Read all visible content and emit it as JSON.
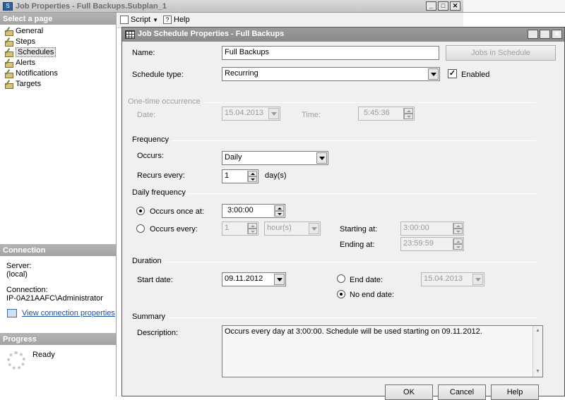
{
  "outer_window": {
    "title": "Job Properties - Full Backups.Subplan_1",
    "select_page_header": "Select a page",
    "pages": [
      {
        "label": "General"
      },
      {
        "label": "Steps"
      },
      {
        "label": "Schedules"
      },
      {
        "label": "Alerts"
      },
      {
        "label": "Notifications"
      },
      {
        "label": "Targets"
      }
    ],
    "toolbar": {
      "script_label": "Script",
      "help_label": "Help"
    },
    "connection": {
      "header": "Connection",
      "server_label": "Server:",
      "server_value": "(local)",
      "connection_label": "Connection:",
      "connection_value": "IP-0A21AAFC\\Administrator",
      "view_link": "View connection properties"
    },
    "progress": {
      "header": "Progress",
      "status": "Ready"
    }
  },
  "dialog": {
    "title": "Job Schedule Properties - Full Backups",
    "name_label": "Name:",
    "name_value": "Full Backups",
    "jobs_button": "Jobs in Schedule",
    "schedule_type_label": "Schedule type:",
    "schedule_type_value": "Recurring",
    "enabled_label": "Enabled",
    "enabled": true,
    "one_time": {
      "header": "One-time occurrence",
      "date_label": "Date:",
      "date_value": "15.04.2013",
      "time_label": "Time:",
      "time_value": "5:45:36"
    },
    "frequency": {
      "header": "Frequency",
      "occurs_label": "Occurs:",
      "occurs_value": "Daily",
      "recurs_label": "Recurs every:",
      "recurs_value": "1",
      "recurs_unit": "day(s)"
    },
    "daily": {
      "header": "Daily frequency",
      "once_label": "Occurs once at:",
      "once_value": "3:00:00",
      "every_label": "Occurs every:",
      "every_value": "1",
      "every_unit": "hour(s)",
      "starting_label": "Starting at:",
      "starting_value": "3:00:00",
      "ending_label": "Ending at:",
      "ending_value": "23:59:59"
    },
    "duration": {
      "header": "Duration",
      "start_label": "Start date:",
      "start_value": "09.11.2012",
      "end_label": "End date:",
      "end_value": "15.04.2013",
      "no_end_label": "No end date:"
    },
    "summary": {
      "header": "Summary",
      "description_label": "Description:",
      "description_value": "Occurs every day at 3:00:00. Schedule will be used starting on 09.11.2012."
    },
    "buttons": {
      "ok": "OK",
      "cancel": "Cancel",
      "help": "Help"
    }
  }
}
